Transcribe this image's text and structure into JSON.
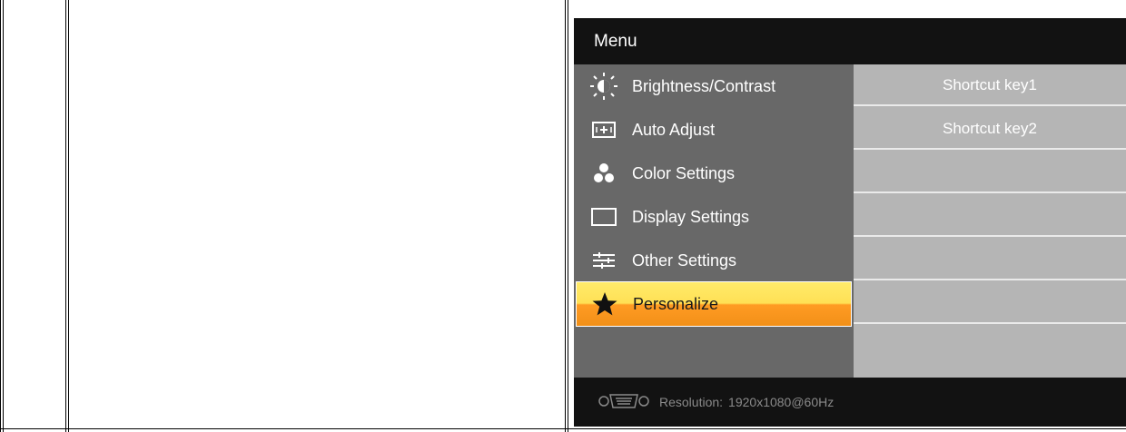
{
  "osd": {
    "title": "Menu",
    "menu_items": [
      {
        "label": "Brightness/Contrast",
        "icon": "brightness-icon"
      },
      {
        "label": "Auto Adjust",
        "icon": "auto-adjust-icon"
      },
      {
        "label": "Color Settings",
        "icon": "color-settings-icon"
      },
      {
        "label": "Display Settings",
        "icon": "display-settings-icon"
      },
      {
        "label": "Other Settings",
        "icon": "other-settings-icon"
      },
      {
        "label": "Personalize",
        "icon": "star-icon",
        "selected": true
      }
    ],
    "sub_items": [
      "Shortcut key1",
      "Shortcut key2",
      "",
      "",
      "",
      "",
      ""
    ],
    "status": {
      "label": "Resolution:",
      "value": "1920x1080@60Hz",
      "icon": "vga-connector-icon"
    },
    "colors": {
      "title_bg": "#121212",
      "menu_bg": "#686868",
      "submenu_bg": "#b5b5b5",
      "highlight_top": "#ffe055",
      "highlight_bottom": "#f29018"
    }
  }
}
